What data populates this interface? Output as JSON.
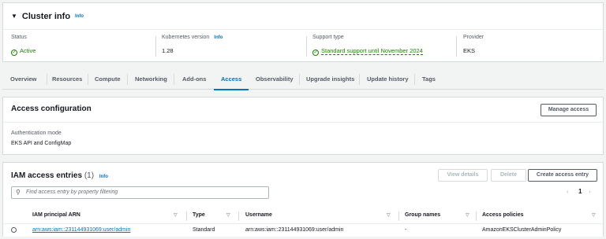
{
  "cluster_info": {
    "title": "Cluster info",
    "info_link": "Info",
    "columns": [
      {
        "label": "Status",
        "value": "Active"
      },
      {
        "label": "Kubernetes version",
        "info": "Info",
        "value": "1.28"
      },
      {
        "label": "Support type",
        "value": "Standard support until November 2024"
      },
      {
        "label": "Provider",
        "value": "EKS"
      }
    ]
  },
  "tabs": [
    "Overview",
    "Resources",
    "Compute",
    "Networking",
    "Add-ons",
    "Access",
    "Observability",
    "Upgrade insights",
    "Update history",
    "Tags"
  ],
  "active_tab": "Access",
  "access_configuration": {
    "title": "Access configuration",
    "manage_button": "Manage access",
    "auth_mode_label": "Authentication mode",
    "auth_mode_value": "EKS API and ConfigMap"
  },
  "iam_entries": {
    "title": "IAM access entries",
    "count": "(1)",
    "info_link": "Info",
    "buttons": {
      "view": "View details",
      "delete": "Delete",
      "create": "Create access entry"
    },
    "search_placeholder": "Find access entry by property filtering",
    "page": "1",
    "columns": [
      "IAM principal ARN",
      "Type",
      "Username",
      "Group names",
      "Access policies"
    ],
    "rows": [
      {
        "arn": "arn:aws:iam::231144931069:user/admin",
        "type": "Standard",
        "username": "arn:aws:iam::231144931069:user/admin",
        "groups": "-",
        "policies": "AmazonEKSClusterAdminPolicy"
      }
    ]
  },
  "colors": {
    "accent": "#0073bb",
    "success": "#1d8102",
    "border": "#d5dbdb"
  }
}
